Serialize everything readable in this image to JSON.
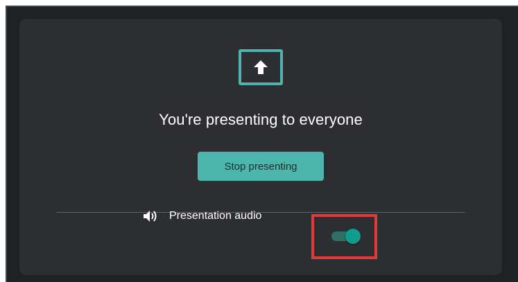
{
  "dialog": {
    "status_text": "You're presenting to everyone",
    "stop_button_label": "Stop presenting",
    "present_icon": "present-to-all-icon"
  },
  "audio": {
    "label": "Presentation audio",
    "icon": "volume-icon",
    "toggle_on": true
  },
  "colors": {
    "accent": "#4db6ac",
    "toggle_thumb": "#0e9d8e",
    "toggle_track": "#2f6f68",
    "background": "#202124",
    "panel": "#2d2e31",
    "highlight": "#e53935"
  }
}
